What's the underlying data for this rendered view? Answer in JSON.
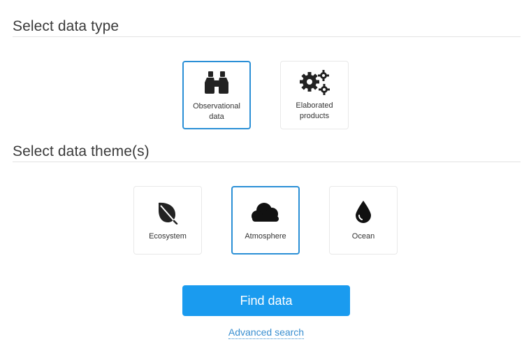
{
  "data_type": {
    "heading": "Select data type",
    "options": [
      {
        "label_line1": "Observational",
        "label_line2": "data",
        "icon": "binoculars-icon",
        "selected": true
      },
      {
        "label_line1": "Elaborated",
        "label_line2": "products",
        "icon": "gears-icon",
        "selected": false
      }
    ]
  },
  "data_theme": {
    "heading": "Select data theme(s)",
    "options": [
      {
        "label": "Ecosystem",
        "icon": "leaf-icon",
        "selected": false
      },
      {
        "label": "Atmosphere",
        "icon": "cloud-icon",
        "selected": true
      },
      {
        "label": "Ocean",
        "icon": "water-drop-icon",
        "selected": false
      }
    ]
  },
  "actions": {
    "find_label": "Find data",
    "advanced_label": "Advanced search"
  },
  "colors": {
    "accent": "#1a9bef",
    "selected_border": "#2a8fd6",
    "link": "#3a8fd0",
    "icon": "#222222"
  }
}
